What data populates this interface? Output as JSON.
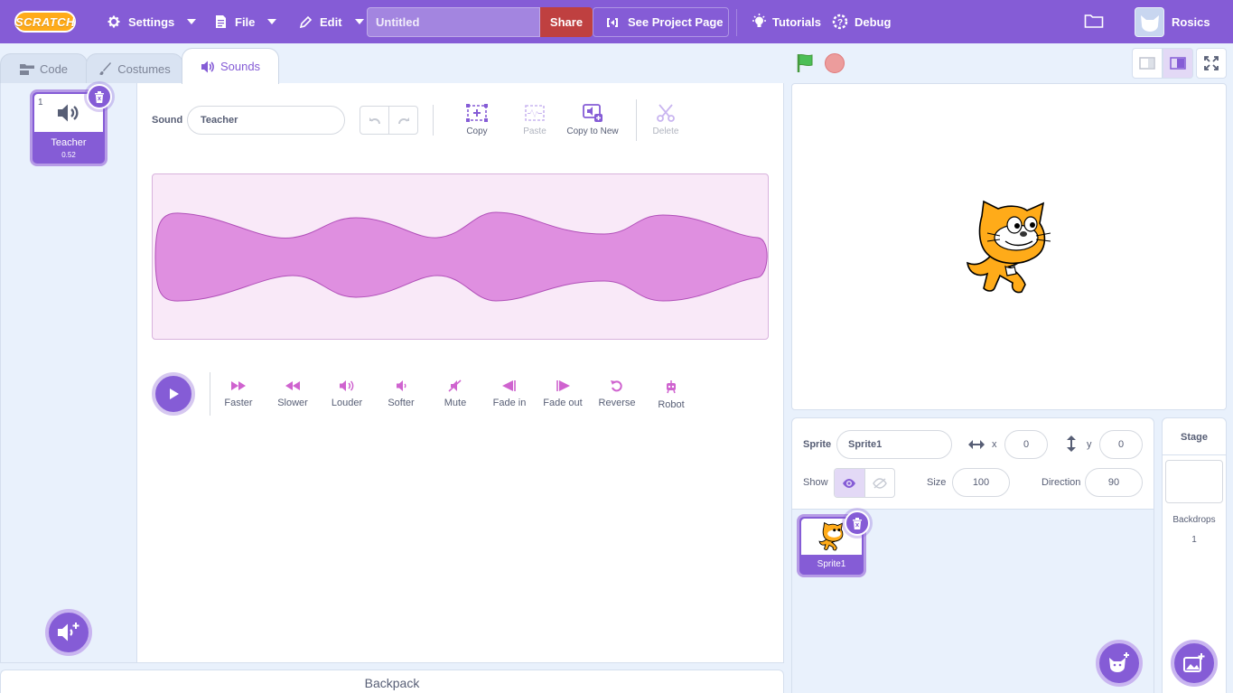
{
  "menubar": {
    "logo": "SCRATCH",
    "settings": "Settings",
    "file": "File",
    "edit": "Edit",
    "title_placeholder": "Untitled",
    "share": "Share",
    "see_project": "See Project Page",
    "tutorials": "Tutorials",
    "debug": "Debug",
    "username": "Rosics"
  },
  "tabs": [
    {
      "label": "Code"
    },
    {
      "label": "Costumes"
    },
    {
      "label": "Sounds",
      "active": true
    }
  ],
  "sounds": [
    {
      "index": "1",
      "name": "Teacher",
      "duration": "0.52"
    }
  ],
  "editor": {
    "sound_label": "Sound",
    "sound_name": "Teacher",
    "tools": {
      "copy": "Copy",
      "paste": "Paste",
      "copy_to_new": "Copy to New",
      "delete": "Delete"
    },
    "effects": [
      "Faster",
      "Slower",
      "Louder",
      "Softer",
      "Mute",
      "Fade in",
      "Fade out",
      "Reverse",
      "Robot"
    ]
  },
  "backpack": "Backpack",
  "sprite_info": {
    "sprite_label": "Sprite",
    "sprite_name": "Sprite1",
    "x_label": "x",
    "x": "0",
    "y_label": "y",
    "y": "0",
    "show_label": "Show",
    "size_label": "Size",
    "size": "100",
    "direction_label": "Direction",
    "direction": "90"
  },
  "sprites": [
    {
      "name": "Sprite1"
    }
  ],
  "stage_pane": {
    "title": "Stage",
    "backdrops_label": "Backdrops",
    "backdrops_count": "1"
  },
  "colors": {
    "accent": "#855cd6",
    "share": "#bf4040",
    "waveform_bg": "#f9e9f8",
    "waveform_fill": "#df8fe0",
    "flag": "#4cbf56"
  }
}
